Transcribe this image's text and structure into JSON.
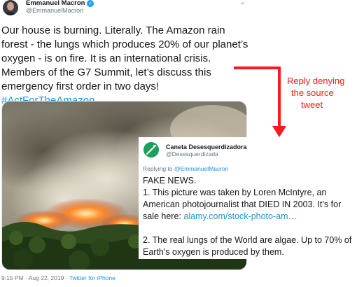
{
  "tweet": {
    "author_name": "Emmanuel Macron",
    "handle": "@EmmanuelMacron",
    "verified_icon": "verified-badge-icon",
    "menu_icon": "chevron-down-icon",
    "text_main": "Our house is burning. Literally. The Amazon rain forest - the lungs which produces 20% of our planet’s oxygen - is on fire. It is an international crisis. Members of the G7 Summit, let’s discuss this emergency first order in two days!",
    "hashtag": "#ActForTheAmazon",
    "timestamp": "9:15 PM · Aug 22, 2019 · ",
    "source": "Twitter for iPhone"
  },
  "annotation": {
    "lines": [
      "Reply denying",
      "the source",
      "tweet"
    ],
    "color": "#ff1a1a"
  },
  "reply": {
    "author_name": "Caneta Desesquerdizadora",
    "handle": "@Desesquerdizada",
    "replying_prefix": "Replying to ",
    "replying_to": "@EmmanuelMacron",
    "line1": "FAKE NEWS.",
    "line2_text": "1. This picture was taken by Loren McIntyre, an American photojournalist that DIED IN 2003. It’s for sale here: ",
    "line2_link": "alamy.com/stock-photo-am…",
    "line3": "2. The real lungs of the World are algae. Up to 70% of Earth's oxygen is produced by them.",
    "avatar_color": "#1aa05a"
  },
  "colors": {
    "link": "#1b95e0",
    "muted": "#657786"
  }
}
